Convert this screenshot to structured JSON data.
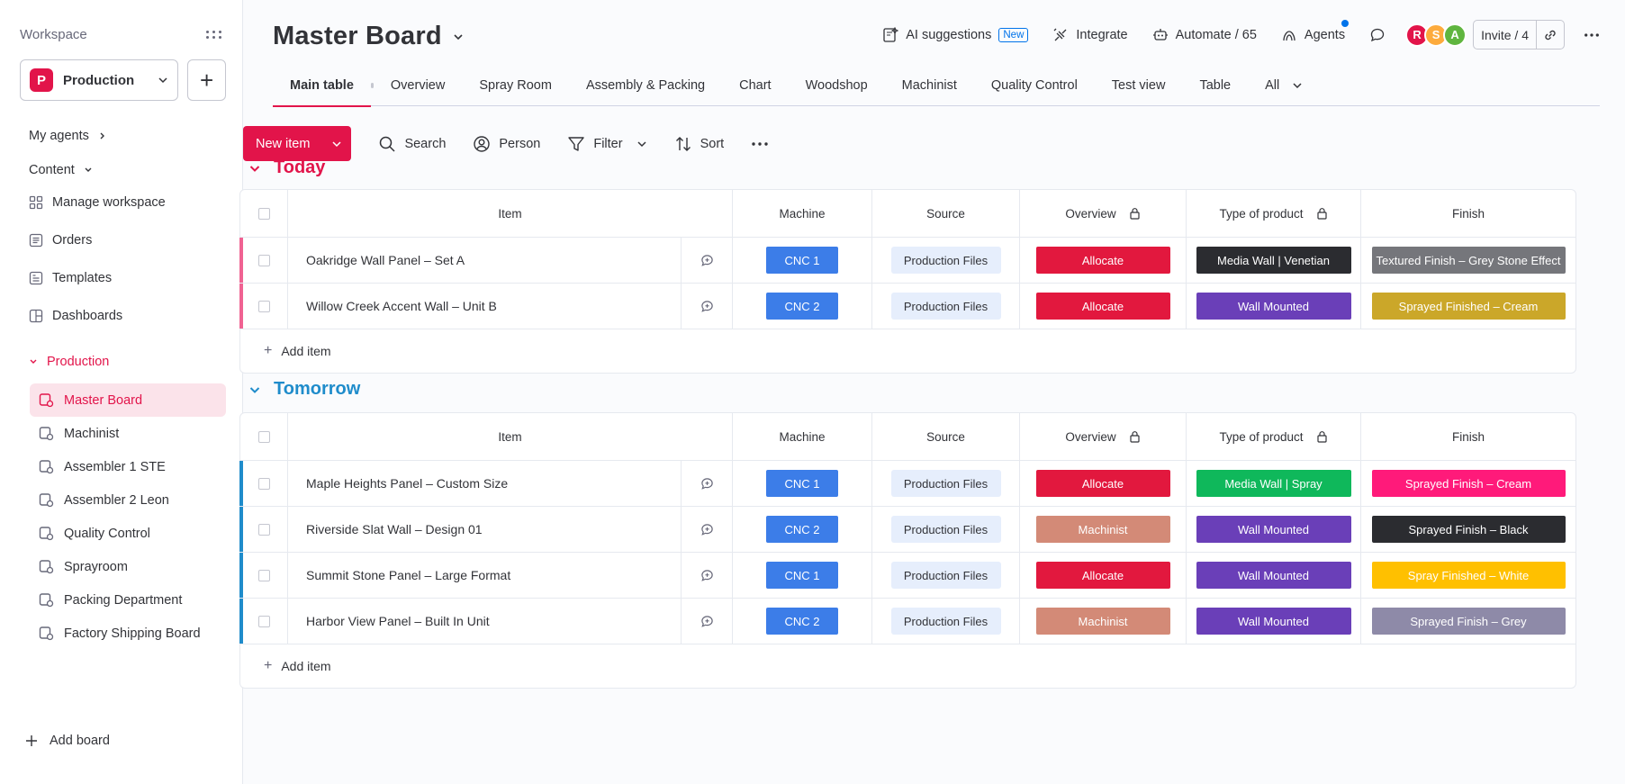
{
  "sidebar": {
    "workspace_label": "Workspace",
    "workspace": {
      "badge": "P",
      "name": "Production"
    },
    "my_agents": "My agents",
    "content": "Content",
    "items": [
      {
        "label": "Manage workspace",
        "icon": "grid-icon"
      },
      {
        "label": "Orders",
        "icon": "board-icon"
      },
      {
        "label": "Templates",
        "icon": "template-icon"
      },
      {
        "label": "Dashboards",
        "icon": "dashboard-icon"
      }
    ],
    "folder": "Production",
    "boards": [
      {
        "label": "Master Board",
        "active": true
      },
      {
        "label": "Machinist"
      },
      {
        "label": "Assembler 1 STE"
      },
      {
        "label": "Assembler 2 Leon"
      },
      {
        "label": "Quality Control"
      },
      {
        "label": "Sprayroom"
      },
      {
        "label": "Packing Department"
      },
      {
        "label": "Factory Shipping Board"
      }
    ],
    "add_board": "Add board"
  },
  "header": {
    "title": "Master Board",
    "ai_suggestions": "AI suggestions",
    "new_badge": "New",
    "integrate": "Integrate",
    "automate": "Automate / 65",
    "agents": "Agents",
    "avatars": [
      {
        "letter": "R",
        "color": "#e2144a"
      },
      {
        "letter": "S",
        "color": "#fdab3d"
      },
      {
        "letter": "A",
        "color": "#5fb53f"
      }
    ],
    "invite": "Invite / 4"
  },
  "tabs": [
    "Main table",
    "Overview",
    "Spray Room",
    "Assembly & Packing",
    "Chart",
    "Woodshop",
    "Machinist",
    "Quality Control",
    "Test view",
    "Table",
    "All"
  ],
  "toolbar": {
    "new_item": "New item",
    "search": "Search",
    "person": "Person",
    "filter": "Filter",
    "sort": "Sort"
  },
  "columns": {
    "item": "Item",
    "machine": "Machine",
    "source": "Source",
    "overview": "Overview",
    "type": "Type of product",
    "finish": "Finish"
  },
  "groups": [
    {
      "title": "Today",
      "color": "#e2144a",
      "bar_color": "#f06292",
      "rows": [
        {
          "item": "Oakridge Wall Panel – Set A",
          "machine": "CNC 1",
          "source": "Production Files",
          "overview": {
            "label": "Allocate",
            "color": "#e2183e"
          },
          "type": {
            "label": "Media Wall | Venetian",
            "color": "#2b2c30"
          },
          "finish": {
            "label": "Textured Finish – Grey Stone Effect",
            "color": "#75767b"
          }
        },
        {
          "item": "Willow Creek Accent Wall – Unit B",
          "machine": "CNC 2",
          "source": "Production Files",
          "overview": {
            "label": "Allocate",
            "color": "#e2183e"
          },
          "type": {
            "label": "Wall Mounted",
            "color": "#6a3fb8"
          },
          "finish": {
            "label": "Sprayed Finished – Cream",
            "color": "#cba729"
          }
        }
      ],
      "add_item": "Add item"
    },
    {
      "title": "Tomorrow",
      "color": "#1f8ccb",
      "bar_color": "#1f8ccb",
      "rows": [
        {
          "item": "Maple Heights Panel – Custom Size",
          "machine": "CNC 1",
          "source": "Production Files",
          "overview": {
            "label": "Allocate",
            "color": "#e2183e"
          },
          "type": {
            "label": "Media Wall | Spray",
            "color": "#0fb85b"
          },
          "finish": {
            "label": "Sprayed Finish – Cream",
            "color": "#ff1a7a"
          }
        },
        {
          "item": "Riverside Slat Wall – Design 01",
          "machine": "CNC 2",
          "source": "Production Files",
          "overview": {
            "label": "Machinist",
            "color": "#d38a77"
          },
          "type": {
            "label": "Wall Mounted",
            "color": "#6a3fb8"
          },
          "finish": {
            "label": "Sprayed Finish – Black",
            "color": "#2b2c30"
          }
        },
        {
          "item": "Summit Stone Panel – Large Format",
          "machine": "CNC 1",
          "source": "Production Files",
          "overview": {
            "label": "Allocate",
            "color": "#e2183e"
          },
          "type": {
            "label": "Wall Mounted",
            "color": "#6a3fb8"
          },
          "finish": {
            "label": "Spray Finished – White",
            "color": "#ffc000"
          }
        },
        {
          "item": "Harbor View Panel – Built In Unit",
          "machine": "CNC 2",
          "source": "Production Files",
          "overview": {
            "label": "Machinist",
            "color": "#d38a77"
          },
          "type": {
            "label": "Wall Mounted",
            "color": "#6a3fb8"
          },
          "finish": {
            "label": "Sprayed Finish – Grey",
            "color": "#8e8aa8"
          }
        }
      ],
      "add_item": "Add item"
    }
  ]
}
